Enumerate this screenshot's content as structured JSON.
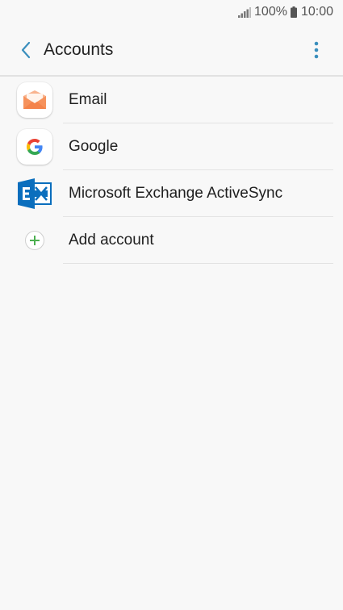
{
  "status_bar": {
    "battery_percent": "100%",
    "time": "10:00",
    "icons": [
      "signal-icon",
      "battery-icon"
    ]
  },
  "header": {
    "title": "Accounts",
    "back_icon": "chevron-left-icon",
    "more_icon": "more-vertical-icon"
  },
  "accounts": [
    {
      "label": "Email",
      "icon": "email-app-icon"
    },
    {
      "label": "Google",
      "icon": "google-icon"
    },
    {
      "label": "Microsoft Exchange ActiveSync",
      "icon": "exchange-icon"
    },
    {
      "label": "Add account",
      "icon": "plus-icon"
    }
  ],
  "colors": {
    "accent": "#3b8fbd",
    "background": "#f8f8f8",
    "add_icon": "#4caf50",
    "exchange_blue": "#0a6ebd",
    "email_orange": "#f6925c"
  }
}
